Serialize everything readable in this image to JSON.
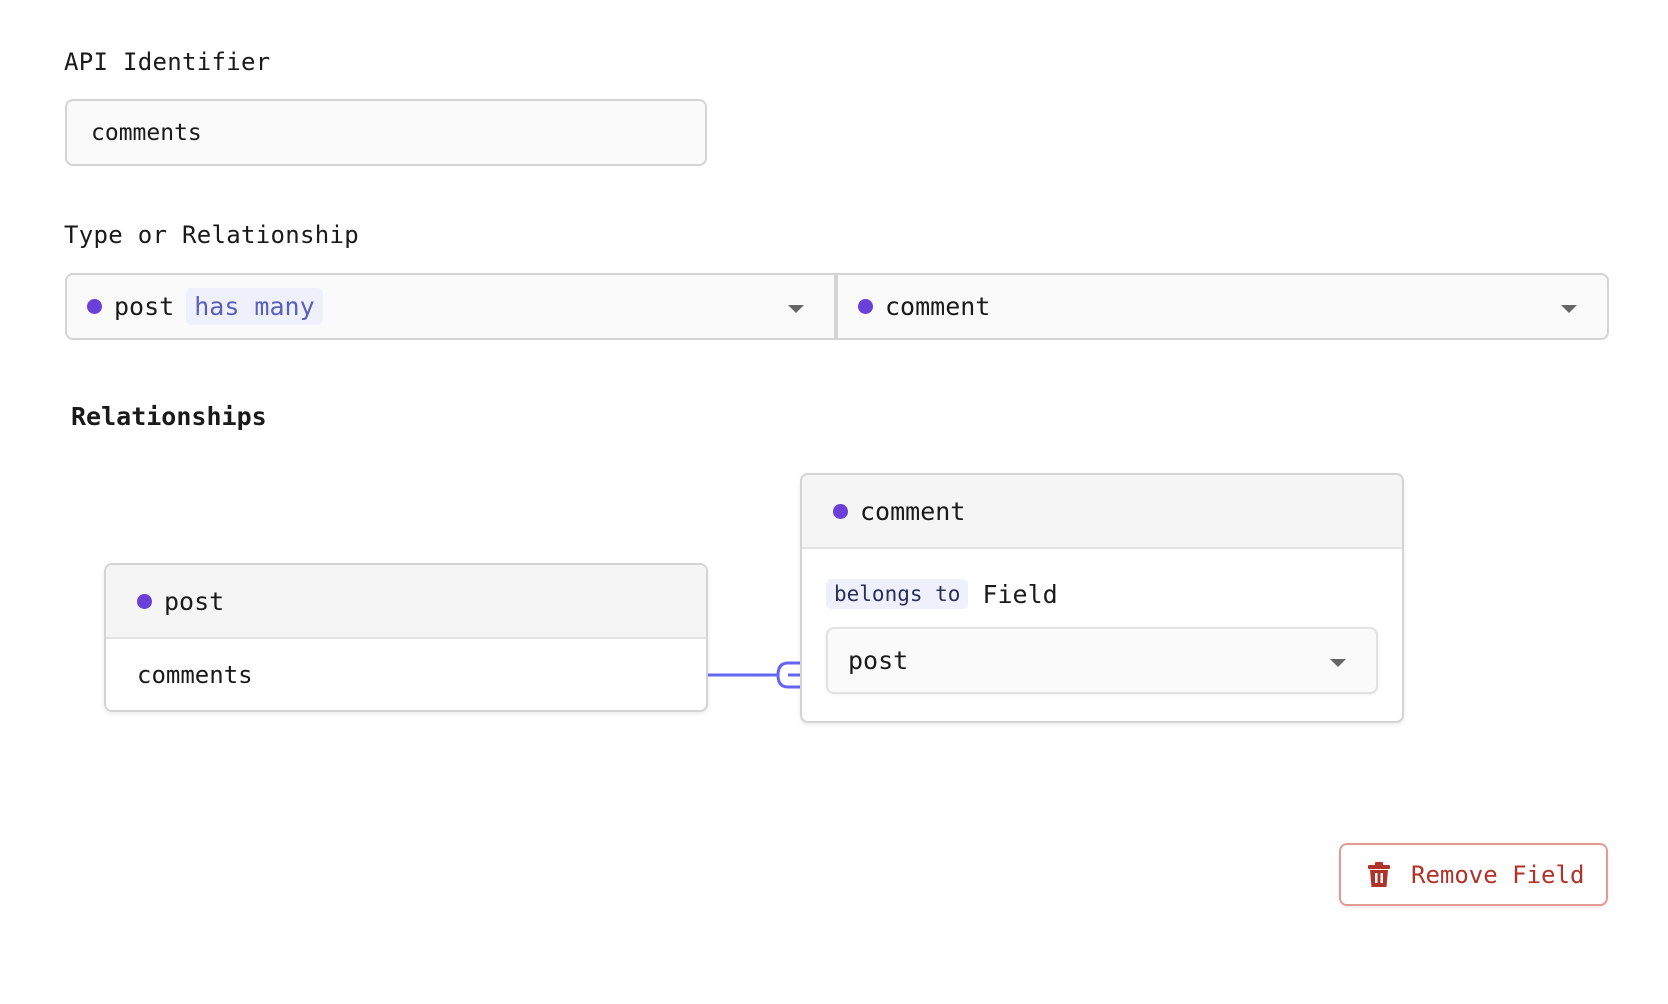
{
  "api_identifier": {
    "label": "API Identifier",
    "value": "comments"
  },
  "type_relationship": {
    "label": "Type or Relationship",
    "left_select": {
      "model": "post",
      "relation": "has many"
    },
    "right_select": {
      "model": "comment"
    }
  },
  "relationships": {
    "title": "Relationships",
    "source_card": {
      "model": "post",
      "field": "comments"
    },
    "target_card": {
      "model": "comment",
      "relation": "belongs to",
      "field_label": "Field",
      "field_select_value": "post"
    }
  },
  "actions": {
    "remove_label": "Remove Field"
  },
  "colors": {
    "model_dot": "#6b3fd9",
    "connector": "#6366f1",
    "danger": "#b0332a"
  }
}
